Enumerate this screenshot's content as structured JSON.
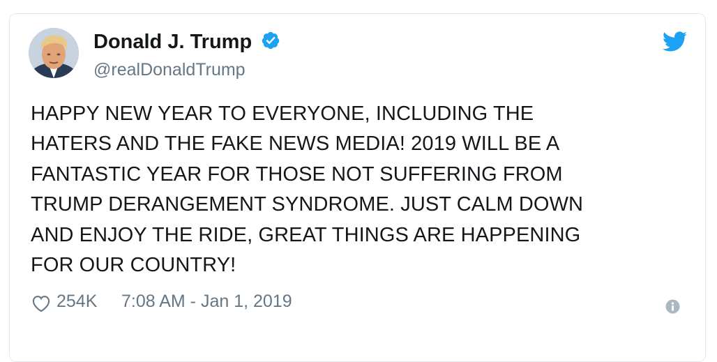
{
  "tweet": {
    "author": {
      "display_name": "Donald J. Trump",
      "handle": "@realDonaldTrump",
      "verified": true,
      "avatar_icon": "profile-photo"
    },
    "text": "HAPPY NEW YEAR TO EVERYONE, INCLUDING THE\nHATERS AND THE FAKE NEWS MEDIA! 2019 WILL BE A\nFANTASTIC YEAR FOR THOSE NOT SUFFERING FROM\nTRUMP DERANGEMENT SYNDROME. JUST CALM DOWN\nAND ENJOY THE RIDE, GREAT THINGS ARE HAPPENING\nFOR OUR COUNTRY!",
    "likes": "254K",
    "timestamp": "7:08 AM - Jan 1, 2019"
  },
  "icons": {
    "brand": "twitter-bird-icon",
    "like": "heart-icon",
    "info": "info-icon",
    "verified": "verified-badge-icon"
  },
  "colors": {
    "brand_blue": "#1da1f2",
    "text": "#14171a",
    "muted": "#657786",
    "border": "#e1e8ed",
    "info_gray": "#aab8c2"
  }
}
